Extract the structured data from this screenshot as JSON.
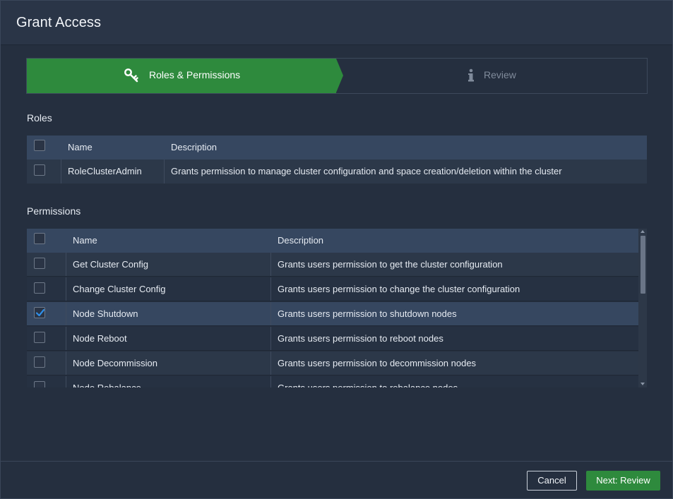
{
  "dialog": {
    "title": "Grant Access"
  },
  "wizard": {
    "steps": [
      {
        "label": "Roles & Permissions",
        "icon": "key-icon",
        "active": true
      },
      {
        "label": "Review",
        "icon": "info-icon",
        "active": false
      }
    ]
  },
  "roles": {
    "section_label": "Roles",
    "columns": [
      "Name",
      "Description"
    ],
    "rows": [
      {
        "name": "RoleClusterAdmin",
        "description": "Grants permission to manage cluster configuration and space creation/deletion within the cluster",
        "checked": false
      }
    ]
  },
  "permissions": {
    "section_label": "Permissions",
    "columns": [
      "Name",
      "Description"
    ],
    "rows": [
      {
        "name": "Get Cluster Config",
        "description": "Grants users permission to get the cluster configuration",
        "checked": false
      },
      {
        "name": "Change Cluster Config",
        "description": "Grants users permission to change the cluster configuration",
        "checked": false
      },
      {
        "name": "Node Shutdown",
        "description": "Grants users permission to shutdown nodes",
        "checked": true
      },
      {
        "name": "Node Reboot",
        "description": "Grants users permission to reboot nodes",
        "checked": false
      },
      {
        "name": "Node Decommission",
        "description": "Grants users permission to decommission nodes",
        "checked": false
      },
      {
        "name": "Node Rebalance",
        "description": "Grants users permission to rebalance nodes",
        "checked": false
      }
    ]
  },
  "footer": {
    "cancel_label": "Cancel",
    "next_label": "Next: Review"
  },
  "colors": {
    "accent_green": "#2e8a3d",
    "check_blue": "#2f8fe8",
    "header_row": "#364760",
    "dialog_bg": "#252f3f"
  }
}
